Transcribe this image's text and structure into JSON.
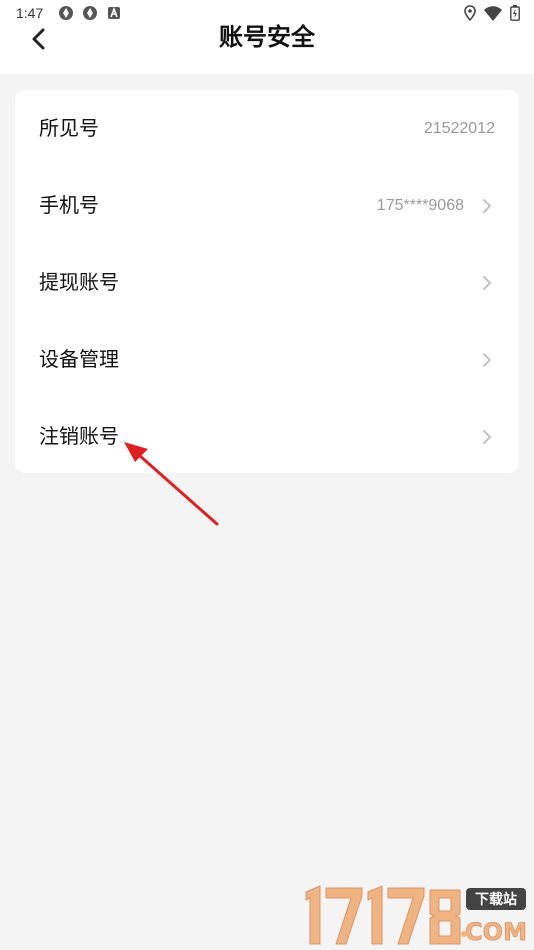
{
  "status_bar": {
    "time": "1:47",
    "icons_left": [
      "app-notification-icon",
      "app-notification-icon",
      "app-a-icon"
    ],
    "icons_right": [
      "location-icon",
      "wifi-icon",
      "battery-icon"
    ]
  },
  "header": {
    "title": "账号安全",
    "back_icon": "chevron-left-icon"
  },
  "rows": [
    {
      "label": "所见号",
      "value": "21522012",
      "chevron": false
    },
    {
      "label": "手机号",
      "value": "175****9068",
      "chevron": true
    },
    {
      "label": "提现账号",
      "value": "",
      "chevron": true
    },
    {
      "label": "设备管理",
      "value": "",
      "chevron": true
    },
    {
      "label": "注销账号",
      "value": "",
      "chevron": true
    }
  ],
  "annotation": {
    "color": "#e02020",
    "points_to": "注销账号"
  },
  "watermark": {
    "brand": "17178",
    "suffix": "下载站",
    "domain": "COM"
  },
  "colors": {
    "page_bg": "#f4f4f4",
    "card_bg": "#ffffff",
    "value_text": "#999999",
    "watermark": "#f0b483"
  }
}
